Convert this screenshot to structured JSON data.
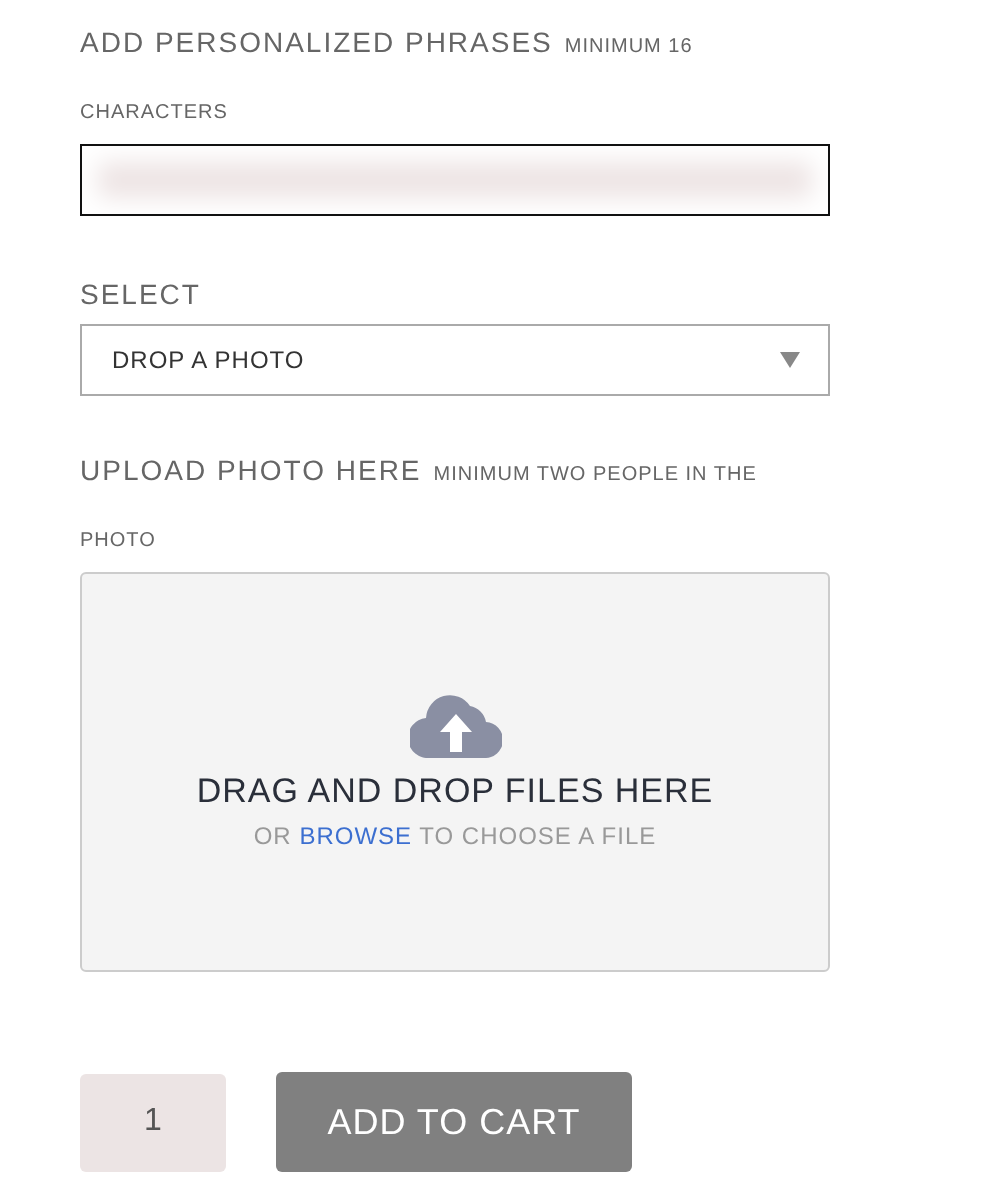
{
  "phrase_field": {
    "label": "ADD PERSONALIZED PHRASES",
    "hint": "MINIMUM 16 CHARACTERS"
  },
  "select_field": {
    "label": "SELECT",
    "value": "DROP A PHOTO"
  },
  "upload": {
    "label": "UPLOAD PHOTO HERE",
    "hint": "MINIMUM TWO PEOPLE IN THE PHOTO",
    "headline": "DRAG AND DROP FILES HERE",
    "prefix": "OR",
    "link": "BROWSE",
    "suffix": "TO CHOOSE A FILE"
  },
  "quantity": "1",
  "add_button": "ADD TO CART"
}
